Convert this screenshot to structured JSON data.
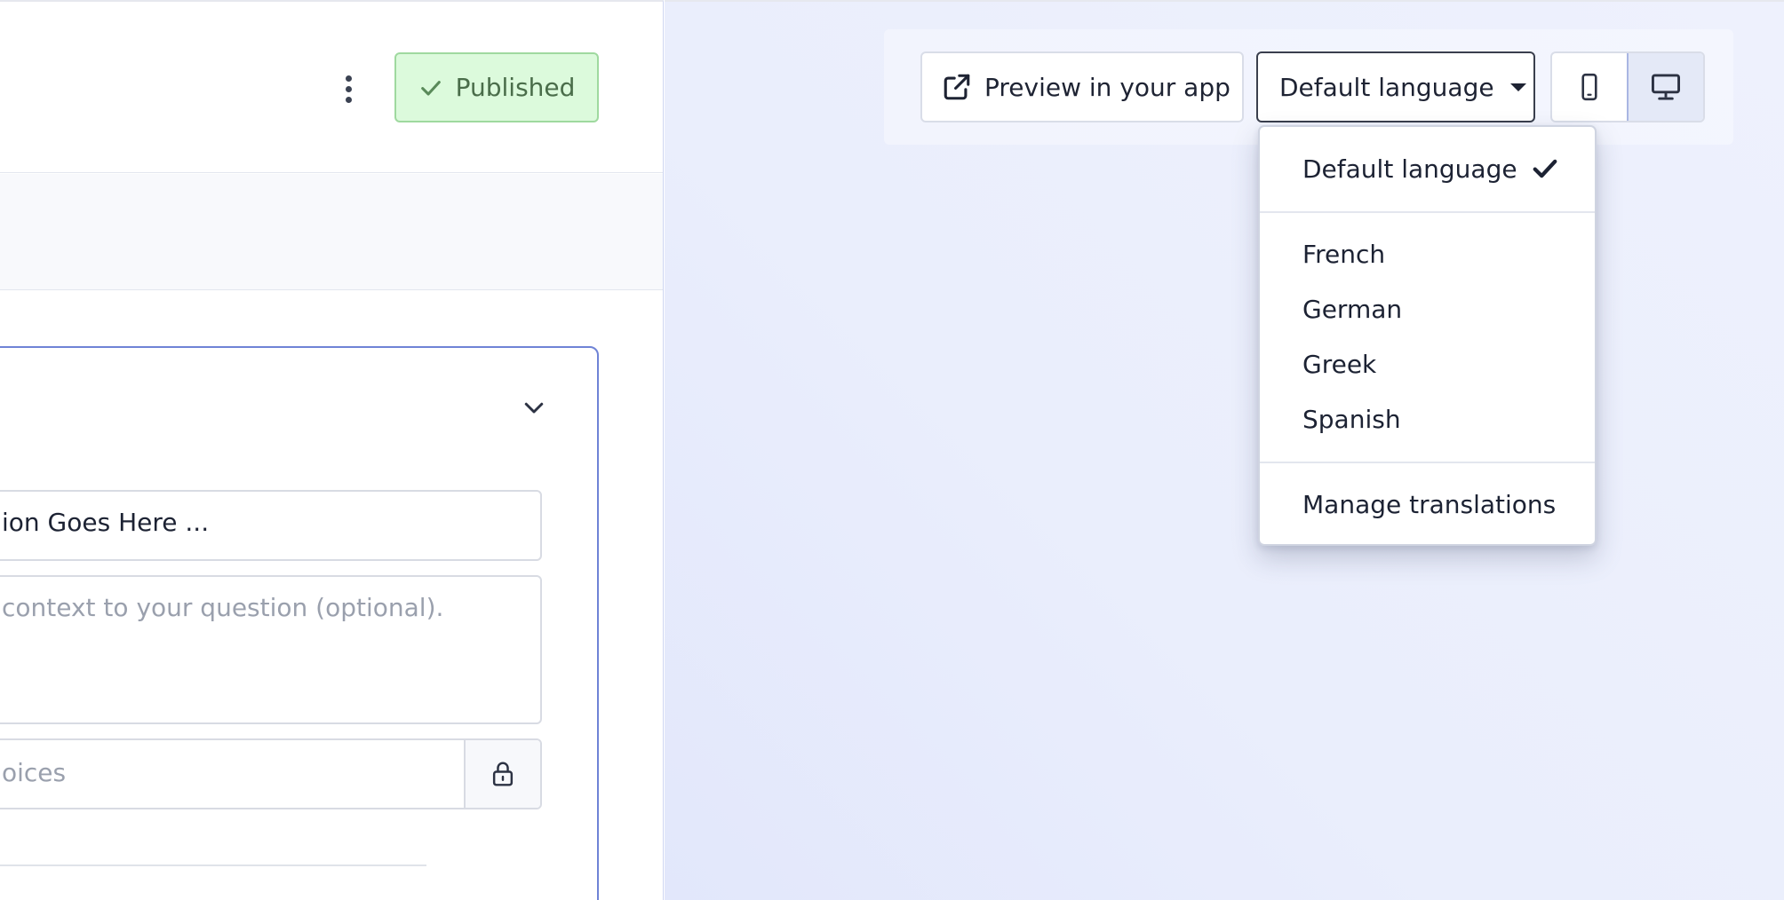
{
  "editor": {
    "status_badge": "Published",
    "question_title_value": "ion Goes Here ...",
    "question_description_placeholder": "context to your question (optional).",
    "choices_placeholder": "oices"
  },
  "preview": {
    "preview_button_label": "Preview in your app",
    "language_button_label": "Default language",
    "device_modes": [
      "mobile",
      "desktop"
    ],
    "active_device": "desktop"
  },
  "language_menu": {
    "default_item": "Default language",
    "languages": [
      "French",
      "German",
      "Greek",
      "Spanish"
    ],
    "manage_label": "Manage translations"
  },
  "colors": {
    "published_bg": "#dcfadc",
    "published_text": "#4a6d4a",
    "card_border": "#6f83d6",
    "preview_bg": "#eaeefc"
  }
}
